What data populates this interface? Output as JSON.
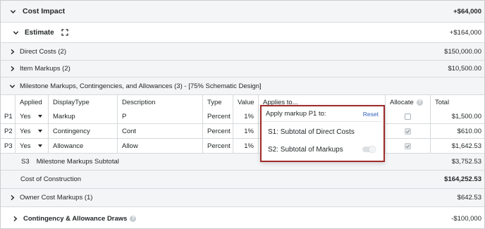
{
  "cost_impact": {
    "label": "Cost Impact",
    "amount": "+$64,000"
  },
  "estimate": {
    "label": "Estimate",
    "amount": "+$164,000"
  },
  "direct_costs": {
    "label": "Direct Costs (2)",
    "amount": "$150,000.00"
  },
  "item_markups": {
    "label": "Item Markups (2)",
    "amount": "$10,500.00"
  },
  "milestone": {
    "label": "Milestone Markups, Contingencies, and Allowances (3) - [75% Schematic Design]"
  },
  "table": {
    "headers": {
      "applied": "Applied",
      "display_type": "DisplayType",
      "description": "Description",
      "type": "Type",
      "value": "Value",
      "applies_to": "Applies to...",
      "allocate": "Allocate",
      "total": "Total"
    },
    "rows": [
      {
        "id": "P1",
        "applied": "Yes",
        "display_type": "Markup",
        "description": "P",
        "type": "Percent",
        "value": "1%",
        "allocate_checked": false,
        "total": "$1,500.00"
      },
      {
        "id": "P2",
        "applied": "Yes",
        "display_type": "Contingency",
        "description": "Cont",
        "type": "Percent",
        "value": "1%",
        "allocate_checked": true,
        "total": "$610.00"
      },
      {
        "id": "P3",
        "applied": "Yes",
        "display_type": "Allowance",
        "description": "Allow",
        "type": "Percent",
        "value": "1%",
        "allocate_checked": true,
        "total": "$1,642.53"
      }
    ],
    "subtotal": {
      "id": "S3",
      "label": "Milestone Markups Subtotal",
      "amount": "$3,752.53"
    }
  },
  "popup": {
    "title": "Apply markup P1 to:",
    "reset": "Reset",
    "options": [
      "S1: Subtotal of Direct Costs",
      "S2: Subtotal of Markups"
    ]
  },
  "cost_of_construction": {
    "label": "Cost of Construction",
    "amount": "$164,252.53"
  },
  "owner_markups": {
    "label": "Owner Cost Markups (1)",
    "amount": "$642.53"
  },
  "draws": {
    "label": "Contingency & Allowance Draws",
    "amount": "-$100,000"
  },
  "colors": {
    "highlight_border": "#a12a2a",
    "link": "#2e5fb8"
  }
}
